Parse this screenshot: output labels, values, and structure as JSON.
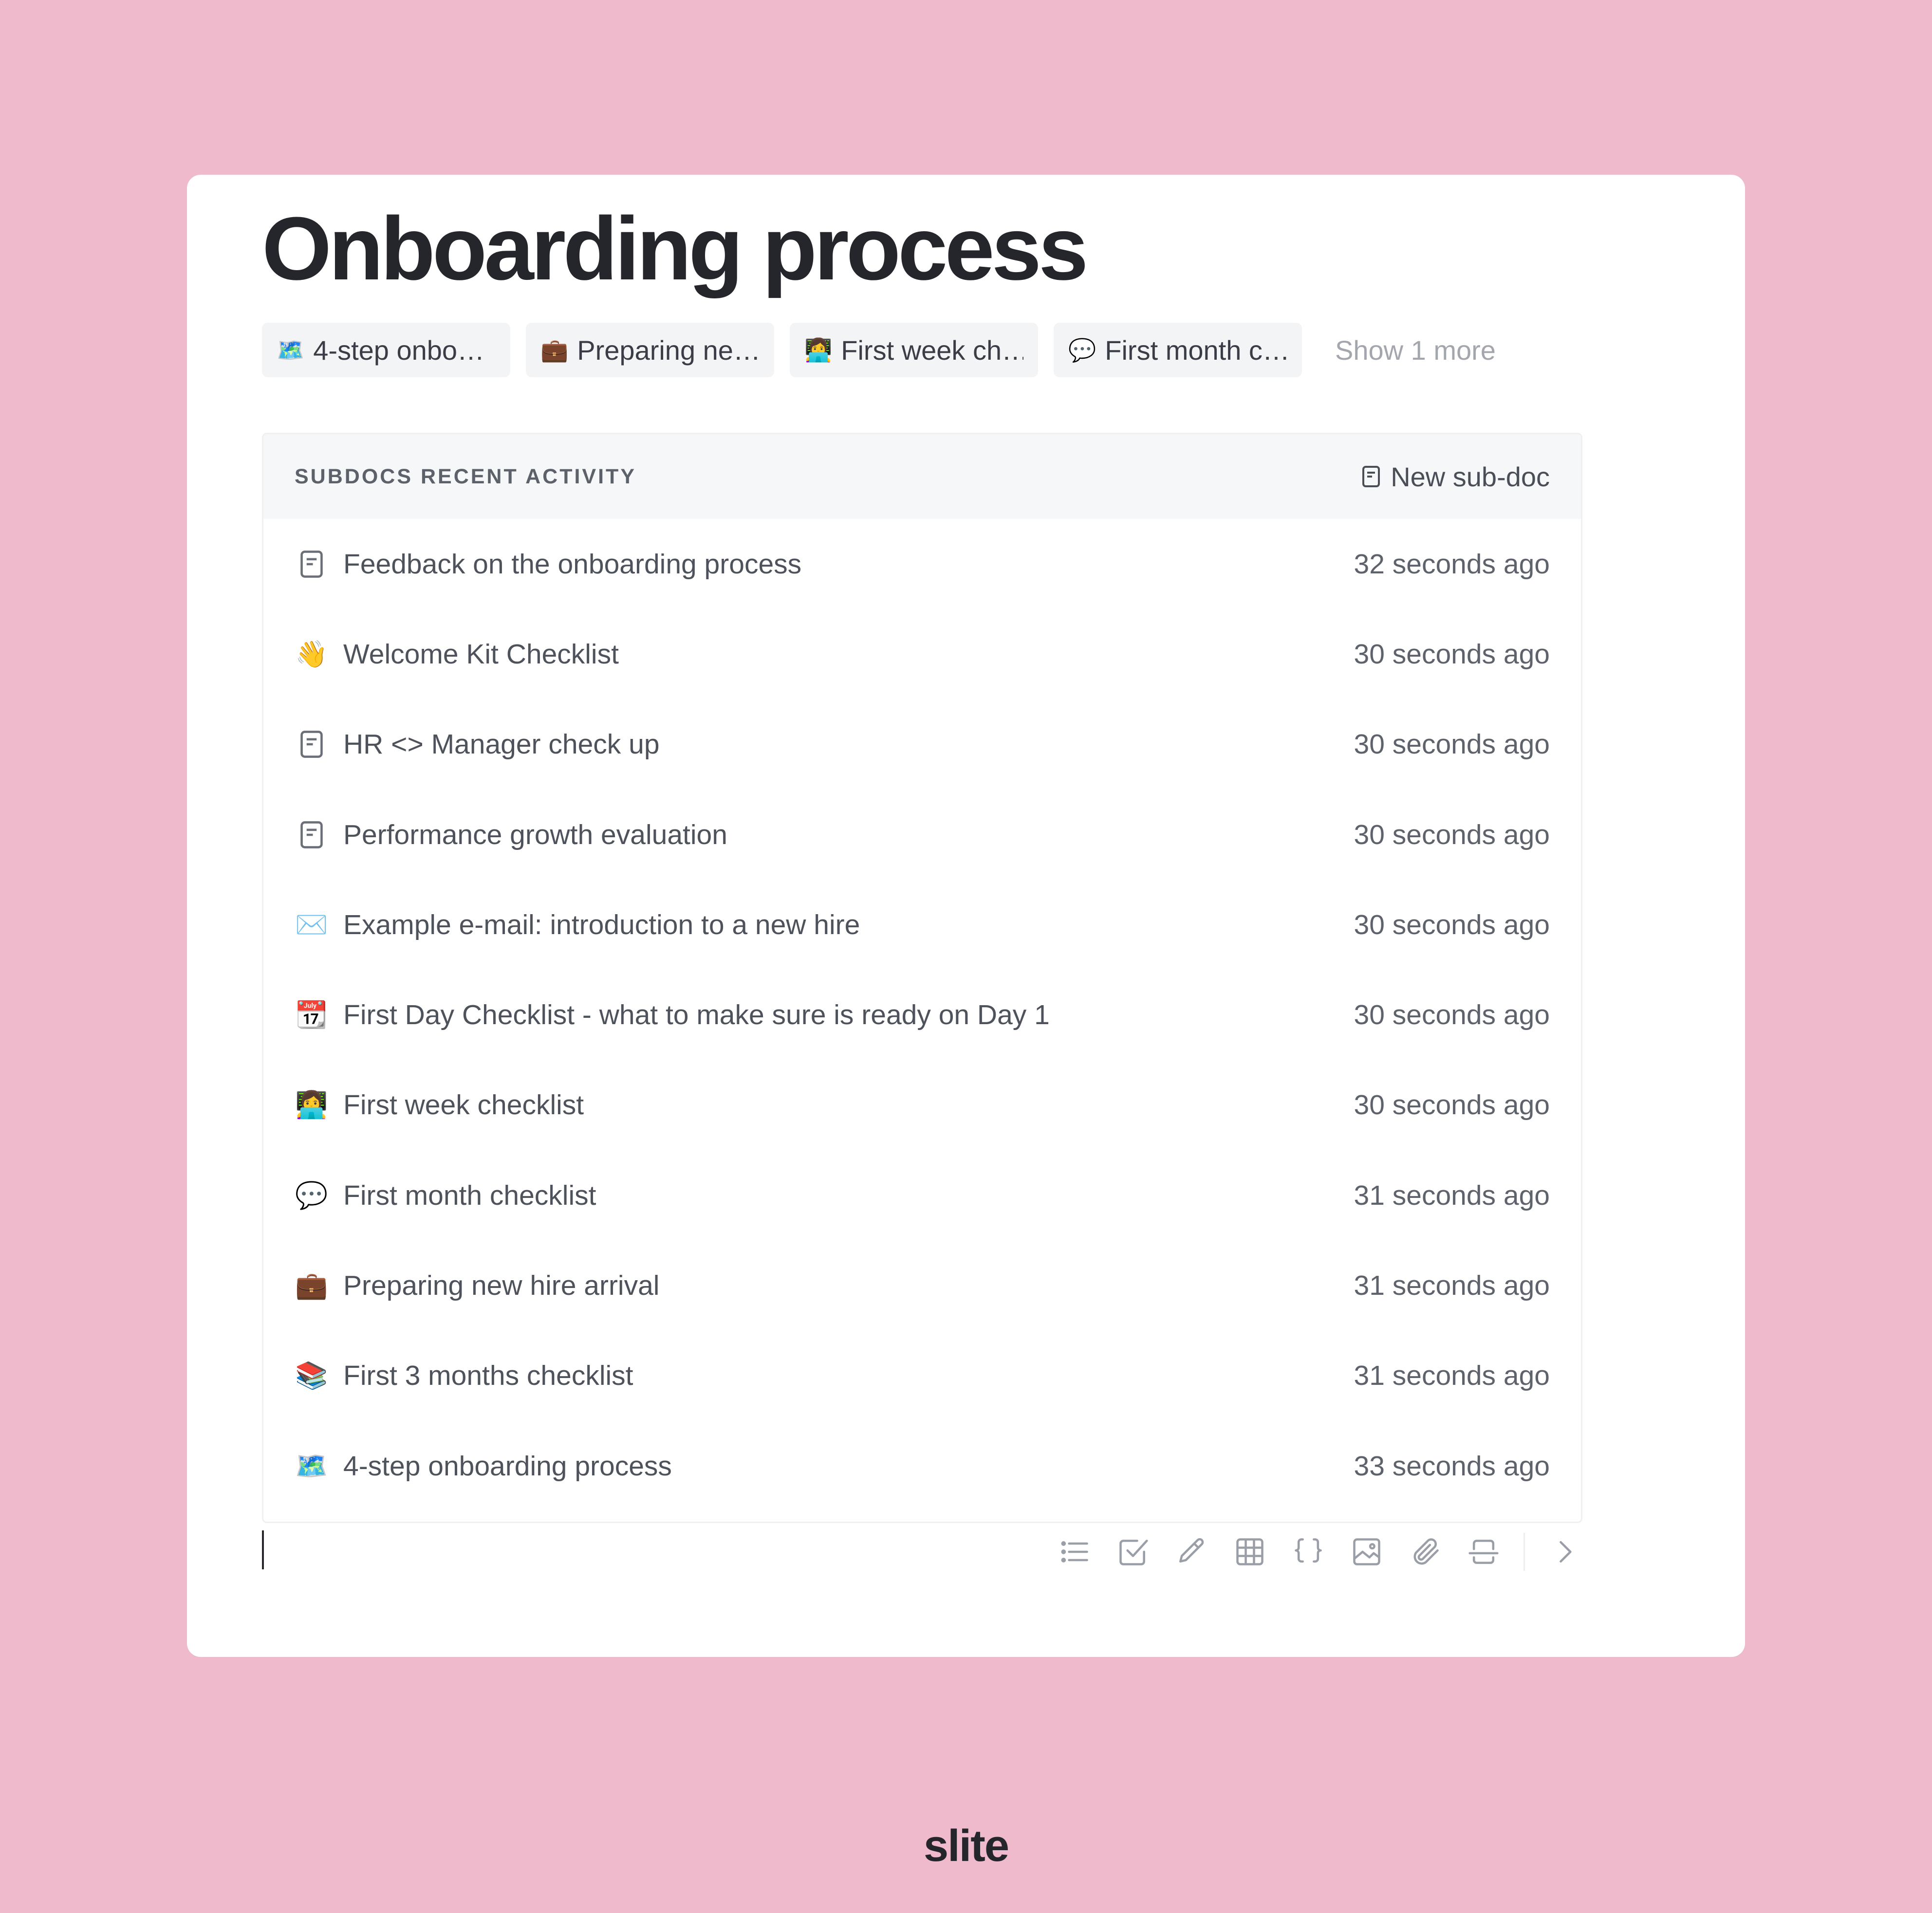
{
  "doc": {
    "title": "Onboarding process",
    "chips": [
      {
        "emoji": "🗺️",
        "label": "4-step onbo…"
      },
      {
        "emoji": "💼",
        "label": "Preparing ne…"
      },
      {
        "emoji": "👩‍💻",
        "label": "First week ch…"
      },
      {
        "emoji": "💬",
        "label": "First month c…"
      }
    ],
    "show_more": "Show 1 more"
  },
  "subdocs": {
    "header": "SUBDOCS RECENT ACTIVITY",
    "new_label": "New sub-doc",
    "rows": [
      {
        "icon": "document-icon",
        "emoji": "",
        "title": "Feedback on the onboarding process",
        "time": "32 seconds ago"
      },
      {
        "icon": "waving-hand-icon",
        "emoji": "👋",
        "title": "Welcome Kit Checklist",
        "time": "30 seconds ago"
      },
      {
        "icon": "document-icon",
        "emoji": "",
        "title": "HR <> Manager check up",
        "time": "30 seconds ago"
      },
      {
        "icon": "document-icon",
        "emoji": "",
        "title": "Performance growth evaluation",
        "time": "30 seconds ago"
      },
      {
        "icon": "envelope-icon",
        "emoji": "✉️",
        "title": "Example e-mail: introduction to a new hire",
        "time": "30 seconds ago"
      },
      {
        "icon": "calendar-icon",
        "emoji": "📆",
        "title": "First Day Checklist - what to make sure is ready on Day 1",
        "time": "30 seconds ago"
      },
      {
        "icon": "technologist-icon",
        "emoji": "👩‍💻",
        "title": "First week checklist",
        "time": "30 seconds ago"
      },
      {
        "icon": "speech-bubble-icon",
        "emoji": "💬",
        "title": "First month checklist",
        "time": "31 seconds ago"
      },
      {
        "icon": "briefcase-icon",
        "emoji": "💼",
        "title": "Preparing new hire arrival",
        "time": "31 seconds ago"
      },
      {
        "icon": "books-icon",
        "emoji": "📚",
        "title": "First 3 months checklist",
        "time": "31 seconds ago"
      },
      {
        "icon": "map-icon",
        "emoji": "🗺️",
        "title": "4-step onboarding process",
        "time": "33 seconds ago"
      }
    ]
  },
  "toolbar": {
    "icons": [
      "bullet-list-icon",
      "checkbox-icon",
      "pencil-icon",
      "table-icon",
      "code-braces-icon",
      "image-icon",
      "link-icon",
      "divider-icon",
      "chevron-right-icon"
    ]
  },
  "brand": "slite",
  "colors": {
    "background": "#efbacb",
    "card": "#ffffff",
    "title": "#25262c",
    "muted": "#a3a6ad",
    "header_bg": "#f6f7f9"
  }
}
